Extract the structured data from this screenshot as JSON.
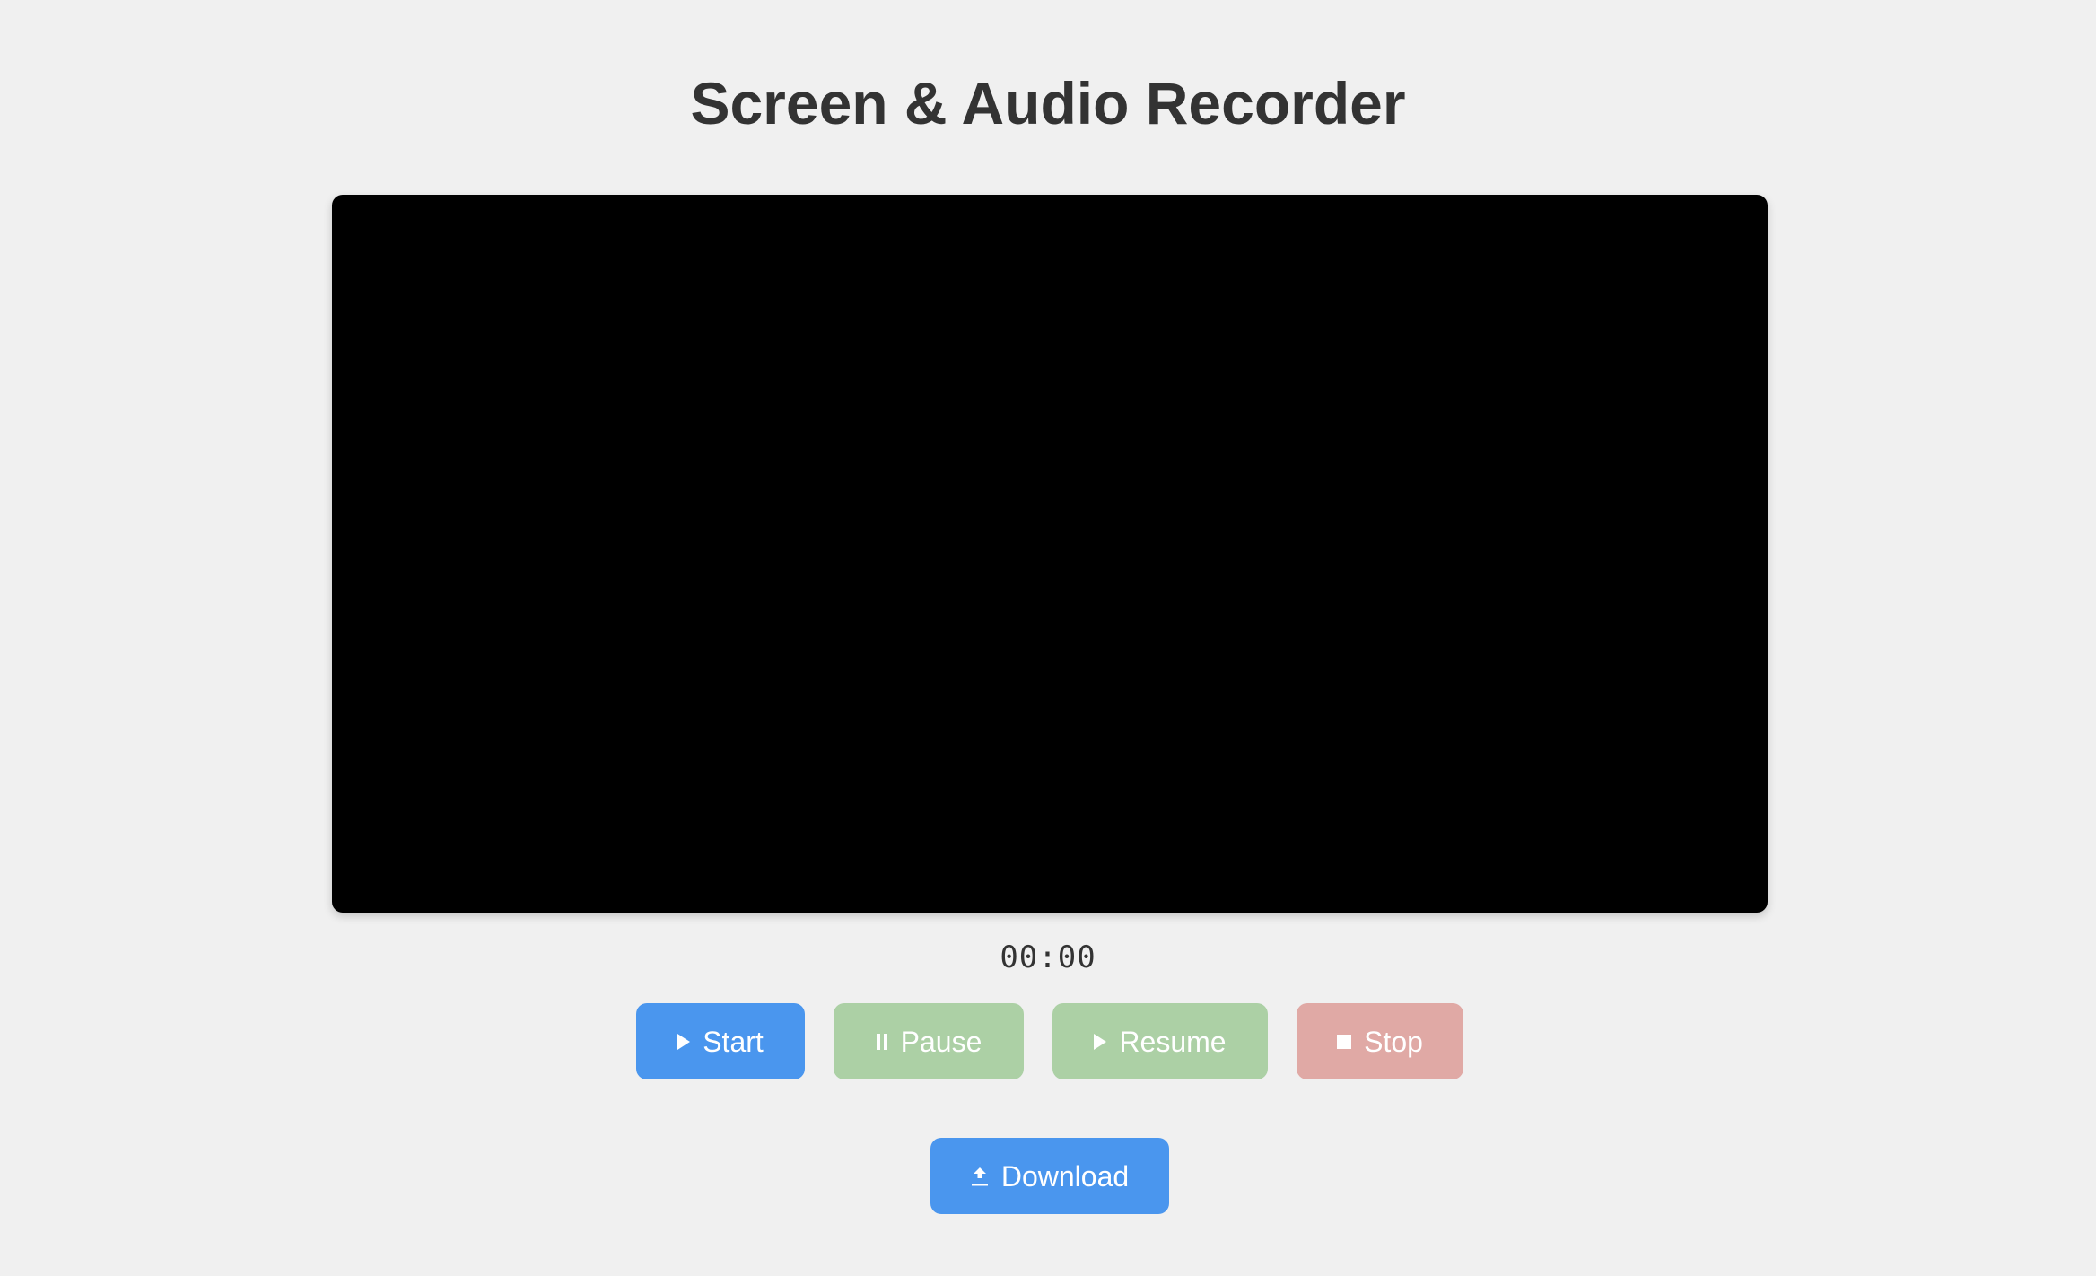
{
  "app": {
    "title": "Screen & Audio Recorder"
  },
  "player": {
    "timer": "00:00"
  },
  "controls": {
    "start": {
      "label": "Start",
      "icon": "play-icon",
      "color": "#4a96ee",
      "enabled": true
    },
    "pause": {
      "label": "Pause",
      "icon": "pause-icon",
      "color": "#acd0a5",
      "enabled": false
    },
    "resume": {
      "label": "Resume",
      "icon": "play-icon",
      "color": "#acd0a5",
      "enabled": false
    },
    "stop": {
      "label": "Stop",
      "icon": "stop-icon",
      "color": "#e0a9a5",
      "enabled": false
    }
  },
  "download": {
    "label": "Download",
    "icon": "upload-arrow-icon",
    "color": "#4a96ee"
  },
  "colors": {
    "background": "#f0f0f0",
    "title_text": "#333333",
    "video_background": "#000000"
  }
}
